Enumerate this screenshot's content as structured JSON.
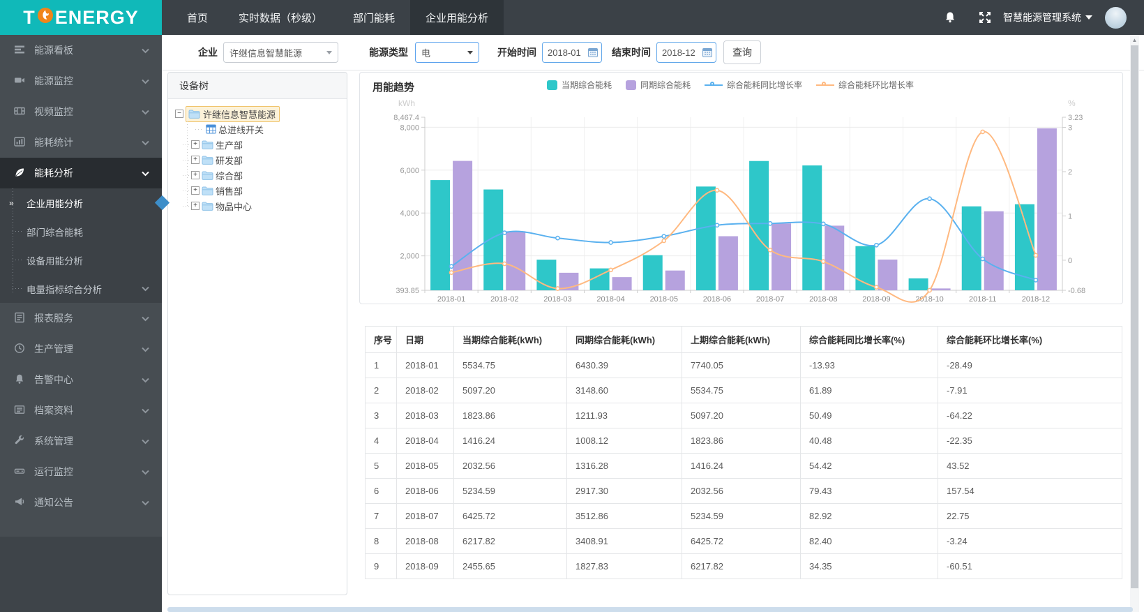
{
  "brand": {
    "prefix": "T",
    "suffix": "ENERGY",
    "accent": "#10b9b9",
    "flame_color": "#f08519"
  },
  "topnav": {
    "items": [
      {
        "label": "首页",
        "active": false
      },
      {
        "label": "实时数据（秒级）",
        "active": false
      },
      {
        "label": "部门能耗",
        "active": false
      },
      {
        "label": "企业用能分析",
        "active": true
      }
    ]
  },
  "topbar": {
    "system_name": "智慧能源管理系统"
  },
  "sidebar": {
    "items": [
      {
        "label": "能源看板",
        "icon": "dashboard"
      },
      {
        "label": "能源监控",
        "icon": "camera"
      },
      {
        "label": "视频监控",
        "icon": "film"
      },
      {
        "label": "能耗统计",
        "icon": "stats"
      },
      {
        "label": "能耗分析",
        "icon": "leaf",
        "expanded": true,
        "children": [
          {
            "label": "企业用能分析",
            "active": true
          },
          {
            "label": "部门综合能耗"
          },
          {
            "label": "设备用能分析"
          },
          {
            "label": "电量指标综合分析",
            "has_children": true
          }
        ]
      },
      {
        "label": "报表服务",
        "icon": "report"
      },
      {
        "label": "生产管理",
        "icon": "clock"
      },
      {
        "label": "告警中心",
        "icon": "bell"
      },
      {
        "label": "档案资料",
        "icon": "archive"
      },
      {
        "label": "系统管理",
        "icon": "wrench"
      },
      {
        "label": "运行监控",
        "icon": "drive"
      },
      {
        "label": "通知公告",
        "icon": "megaphone"
      }
    ],
    "active_marker_color": "#3d8ec9"
  },
  "filters": {
    "company_label": "企业",
    "company_value": "许继信息智慧能源",
    "energy_label": "能源类型",
    "energy_value": "电",
    "start_label": "开始时间",
    "start_value": "2018-01",
    "end_label": "结束时间",
    "end_value": "2018-12",
    "query_button": "查询"
  },
  "tree": {
    "header": "设备树",
    "root": {
      "label": "许继信息智慧能源",
      "selected": true
    },
    "children": [
      {
        "label": "总进线开关",
        "type": "device"
      },
      {
        "label": "生产部",
        "type": "folder"
      },
      {
        "label": "研发部",
        "type": "folder"
      },
      {
        "label": "综合部",
        "type": "folder"
      },
      {
        "label": "销售部",
        "type": "folder"
      },
      {
        "label": "物品中心",
        "type": "folder"
      }
    ]
  },
  "chart_data": {
    "type": "bar+line",
    "title": "用能趋势",
    "grid": true,
    "legend_position": "top",
    "categories": [
      "2018-01",
      "2018-02",
      "2018-03",
      "2018-04",
      "2018-05",
      "2018-06",
      "2018-07",
      "2018-08",
      "2018-09",
      "2018-10",
      "2018-11",
      "2018-12"
    ],
    "series": [
      {
        "name": "当期综合能耗",
        "type": "bar",
        "axis": "left",
        "color": "#2ec7c9",
        "values": [
          5534.75,
          5097.2,
          1823.86,
          1416.24,
          2032.56,
          5234.59,
          6425.72,
          6217.82,
          2455.65,
          950,
          4310,
          4410
        ]
      },
      {
        "name": "同期综合能耗",
        "type": "bar",
        "axis": "left",
        "color": "#b6a2de",
        "values": [
          6430.39,
          3148.6,
          1211.93,
          1008.12,
          1316.28,
          2917.3,
          3512.86,
          3408.91,
          1827.83,
          480,
          4080,
          7950
        ]
      },
      {
        "name": "综合能耗同比增长率",
        "type": "line",
        "axis": "right",
        "color": "#5ab1ef",
        "values": [
          -0.14,
          0.62,
          0.5,
          0.4,
          0.54,
          0.79,
          0.83,
          0.82,
          0.34,
          1.39,
          0.03,
          -0.45
        ]
      },
      {
        "name": "综合能耗环比增长率",
        "type": "line",
        "axis": "right",
        "color": "#ffb980",
        "values": [
          -0.28,
          -0.08,
          -0.64,
          -0.22,
          0.44,
          1.58,
          0.23,
          -0.03,
          -0.61,
          -0.68,
          2.9,
          0.11
        ]
      }
    ],
    "left_axis": {
      "name": "kWh",
      "min": 393.85,
      "max": 8467.4,
      "ticks": [
        {
          "v": 393.85,
          "label": "393.85"
        },
        {
          "v": 2000,
          "label": "2,000"
        },
        {
          "v": 4000,
          "label": "4,000"
        },
        {
          "v": 6000,
          "label": "6,000"
        },
        {
          "v": 8000,
          "label": "8,000"
        },
        {
          "v": 8467.4,
          "label": "8,467.4"
        }
      ]
    },
    "right_axis": {
      "name": "%",
      "min": -0.68,
      "max": 3.23,
      "ticks": [
        {
          "v": -0.68,
          "label": "-0.68"
        },
        {
          "v": 0,
          "label": "0"
        },
        {
          "v": 1,
          "label": "1"
        },
        {
          "v": 2,
          "label": "2"
        },
        {
          "v": 3,
          "label": "3"
        },
        {
          "v": 3.23,
          "label": "3.23"
        }
      ]
    }
  },
  "table": {
    "columns": [
      "序号",
      "日期",
      "当期综合能耗(kWh)",
      "同期综合能耗(kWh)",
      "上期综合能耗(kWh)",
      "综合能耗同比增长率(%)",
      "综合能耗环比增长率(%)"
    ],
    "rows": [
      [
        "1",
        "2018-01",
        "5534.75",
        "6430.39",
        "7740.05",
        "-13.93",
        "-28.49"
      ],
      [
        "2",
        "2018-02",
        "5097.20",
        "3148.60",
        "5534.75",
        "61.89",
        "-7.91"
      ],
      [
        "3",
        "2018-03",
        "1823.86",
        "1211.93",
        "5097.20",
        "50.49",
        "-64.22"
      ],
      [
        "4",
        "2018-04",
        "1416.24",
        "1008.12",
        "1823.86",
        "40.48",
        "-22.35"
      ],
      [
        "5",
        "2018-05",
        "2032.56",
        "1316.28",
        "1416.24",
        "54.42",
        "43.52"
      ],
      [
        "6",
        "2018-06",
        "5234.59",
        "2917.30",
        "2032.56",
        "79.43",
        "157.54"
      ],
      [
        "7",
        "2018-07",
        "6425.72",
        "3512.86",
        "5234.59",
        "82.92",
        "22.75"
      ],
      [
        "8",
        "2018-08",
        "6217.82",
        "3408.91",
        "6425.72",
        "82.40",
        "-3.24"
      ],
      [
        "9",
        "2018-09",
        "2455.65",
        "1827.83",
        "6217.82",
        "34.35",
        "-60.51"
      ]
    ]
  }
}
